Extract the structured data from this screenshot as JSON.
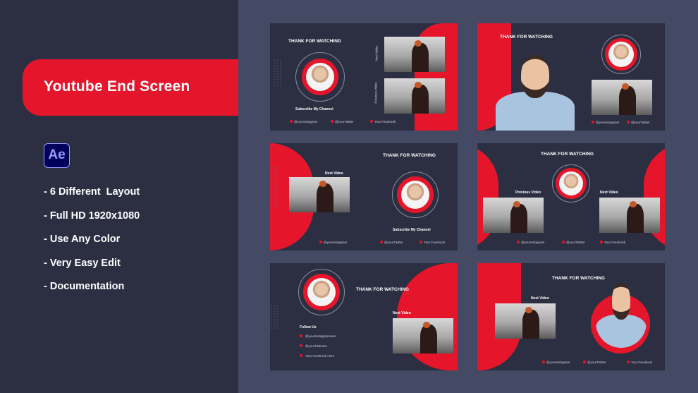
{
  "banner": {
    "title": "Youtube End Screen"
  },
  "app_badge": {
    "label": "Ae"
  },
  "features": [
    "- 6 Different  Layout",
    "- Full HD 1920x1080",
    "- Use Any Color",
    "- Very Easy Edit",
    "- Documentation"
  ],
  "colors": {
    "accent": "#e5162b",
    "panel": "#2c2f41",
    "background": "#444a63"
  },
  "cards": {
    "c1": {
      "heading": "THANK FOR WATCHING",
      "subscribe": "Subscribe My Channel",
      "next": "Next Video",
      "prev": "Previous Video",
      "s1": "@yourInstagram",
      "s2": "@yourTwitter",
      "s3": "Your Facebook"
    },
    "c2": {
      "heading": "THANK FOR WATCHING",
      "s1": "@yourInstagram",
      "s2": "@yourTwitter"
    },
    "c3": {
      "heading": "THANK FOR WATCHING",
      "next": "Next Video",
      "subscribe": "Subscribe My Channel",
      "s1": "@yourInstagram",
      "s2": "@yourTwitter",
      "s3": "Your Facebook"
    },
    "c4": {
      "heading": "THANK FOR WATCHING",
      "prev": "Previous Video",
      "next": "Next Video",
      "s1": "@yourInstagram",
      "s2": "@yourTwitter",
      "s3": "Your Facebook"
    },
    "c5": {
      "heading": "THANK FOR WATCHING",
      "next": "Next Video",
      "follow": "Follow Us",
      "s1": "@yourInstagramHere",
      "s2": "@yourTwitHere",
      "s3": "Your Facebook Here"
    },
    "c6": {
      "heading": "THANK FOR WATCHING",
      "next": "Next Video",
      "s1": "@yourInstagram",
      "s2": "@yourTwitter",
      "s3": "Your Facebook"
    }
  }
}
